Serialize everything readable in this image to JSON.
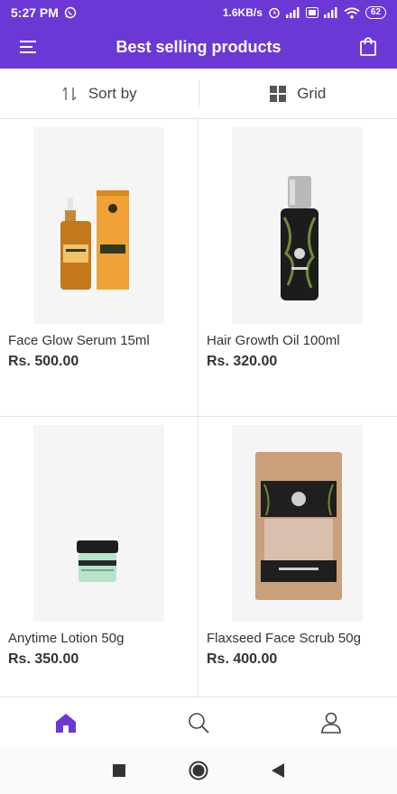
{
  "status_bar": {
    "time": "5:27 PM",
    "network_speed": "1.6KB/s",
    "battery": "62",
    "icons": [
      "whatsapp-icon",
      "alarm-icon",
      "signal-icon",
      "volte-icon",
      "wifi-icon",
      "battery-icon"
    ]
  },
  "app_bar": {
    "title": "Best selling products",
    "left_icon": "menu-icon",
    "right_icon": "shopping-bag-icon",
    "color": "#6b38d6"
  },
  "toolbar": {
    "sort_label": "Sort by",
    "sort_icon": "sort-icon",
    "view_label": "Grid",
    "view_icon": "grid-icon"
  },
  "products": [
    {
      "name": "Face Glow Serum 15ml",
      "price": "Rs. 500.00"
    },
    {
      "name": "Hair Growth Oil 100ml",
      "price": "Rs. 320.00"
    },
    {
      "name": "Anytime Lotion 50g",
      "price": "Rs. 350.00"
    },
    {
      "name": "Flaxseed Face Scrub 50g",
      "price": "Rs. 400.00"
    }
  ],
  "bottom_nav": {
    "items": [
      "home-icon",
      "search-icon",
      "profile-icon"
    ],
    "active": "home-icon",
    "active_color": "#6b38d6"
  },
  "system_nav": [
    "recents-icon",
    "home-circle-icon",
    "back-icon"
  ]
}
